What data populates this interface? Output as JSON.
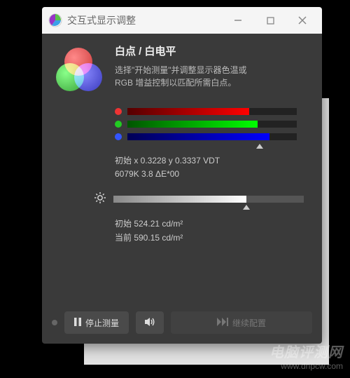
{
  "window": {
    "title": "交互式显示调整"
  },
  "header": {
    "title": "白点 / 白电平",
    "desc_line1": "选择\"开始测量\"并调整显示器色温或",
    "desc_line2": "RGB 增益控制以匹配所需白点。"
  },
  "rgb": {
    "r_pct": 72,
    "g_pct": 77,
    "b_pct": 84
  },
  "readout1": {
    "line1": "初始 x 0.3228 y 0.3337 VDT",
    "line2": "6079K 3.8 ΔE*00"
  },
  "brightness": {
    "pct": 70
  },
  "readout2": {
    "line1": "初始 524.21 cd/m²",
    "line2": "当前 590.15 cd/m²"
  },
  "buttons": {
    "stop": "停止测量",
    "continue": "继续配置"
  },
  "watermark": {
    "cn": "电脑评测网",
    "en": "www.dnpcw.com"
  }
}
